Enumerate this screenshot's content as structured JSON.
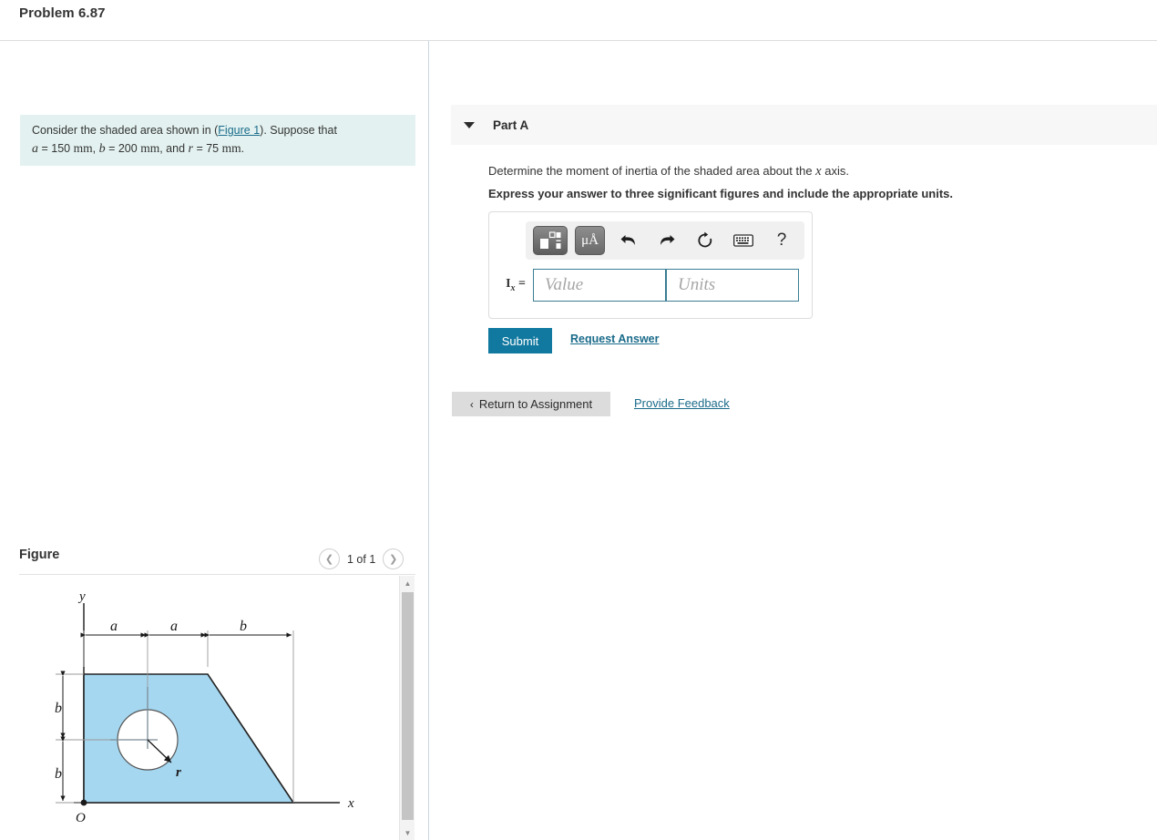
{
  "header": {
    "title": "Problem 6.87"
  },
  "problem": {
    "lead": "Consider the shaded area shown in (",
    "figure_link": "Figure 1",
    "after_link": "). Suppose that",
    "var_a": "a",
    "eq1": "= 150",
    "unit1": "mm",
    "comma1": ",",
    "var_b": "b",
    "eq2": "= 200",
    "unit2": "mm",
    "comma2": ", and",
    "var_r": "r",
    "eq3": "= 75",
    "unit3": "mm",
    "period": "."
  },
  "figure": {
    "title": "Figure",
    "count_label": "1 of 1",
    "prev_icon": "chevron-left-icon",
    "next_icon": "chevron-right-icon",
    "labels": {
      "y_axis": "y",
      "x_axis": "x",
      "origin": "O",
      "dim_a1": "a",
      "dim_a2": "a",
      "dim_b_top": "b",
      "dim_b_left_upper": "b",
      "dim_b_left_lower": "b",
      "radius": "r"
    },
    "colors": {
      "shape_fill": "#a5d7f0",
      "shape_stroke": "#222222"
    }
  },
  "part": {
    "label": "Part A",
    "caret_icon": "caret-down-icon",
    "question": "Determine the moment of inertia of the shaded area about the ",
    "question_var": "x",
    "question_tail": " axis.",
    "instruction": "Express your answer to three significant figures and include the appropriate units."
  },
  "answer": {
    "label_base": "I",
    "label_sub": "x",
    "label_eq": "=",
    "value_placeholder": "Value",
    "units_placeholder": "Units",
    "value": "",
    "units": "",
    "toolbar": {
      "template_icon": "math-template-icon",
      "units_icon": "micro-angstrom-icon",
      "units_text": "μÅ",
      "undo_icon": "undo-arrow-icon",
      "redo_icon": "redo-arrow-icon",
      "reset_icon": "reset-circle-icon",
      "keyboard_icon": "keyboard-icon",
      "help_icon": "help-question-icon",
      "help_text": "?"
    }
  },
  "actions": {
    "submit": "Submit",
    "request_answer": "Request Answer",
    "return_chevron": "‹",
    "return_to_assignment": "Return to Assignment",
    "provide_feedback": "Provide Feedback"
  },
  "colors": {
    "accent": "#1179a0",
    "link": "#1a6b8a",
    "problem_bg": "#e3f2f0",
    "part_header_bg": "#f7f7f7"
  }
}
